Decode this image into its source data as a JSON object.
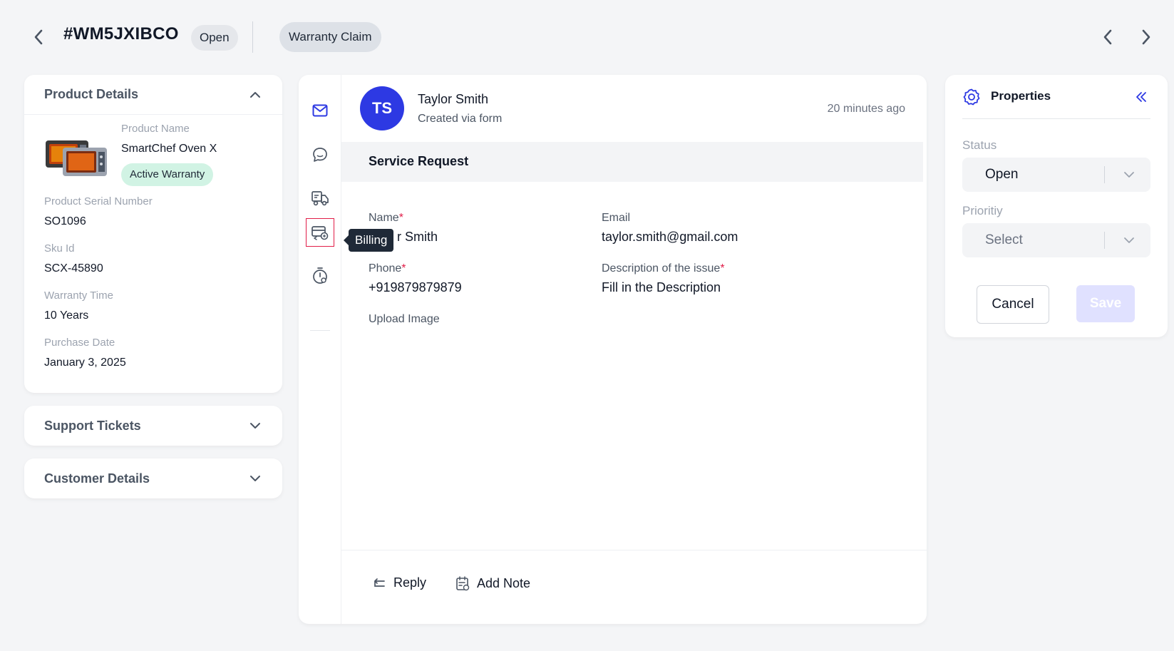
{
  "header": {
    "ticket_id": "#WM5JXIBCO",
    "status": "Open",
    "ticket_type": "Warranty Claim"
  },
  "product_details": {
    "title": "Product Details",
    "product_name_label": "Product Name",
    "product_name": "SmartChef Oven X",
    "warranty_badge": "Active Warranty",
    "fields": [
      {
        "label": "Product Serial Number",
        "value": "SO1096"
      },
      {
        "label": "Sku Id",
        "value": "SCX-45890"
      },
      {
        "label": "Warranty Time",
        "value": "10 Years"
      },
      {
        "label": "Purchase Date",
        "value": "January 3, 2025"
      }
    ]
  },
  "support_tickets": {
    "title": "Support Tickets"
  },
  "customer_details": {
    "title": "Customer Details"
  },
  "rail": {
    "tooltip": "Billing",
    "icons": [
      "mail-icon",
      "chat-icon",
      "truck-icon",
      "billing-icon",
      "timer-icon"
    ]
  },
  "message": {
    "avatar_initials": "TS",
    "sender": "Taylor Smith",
    "via": "Created via form",
    "time": "20 minutes ago",
    "section_title": "Service Request",
    "form": {
      "name_label": "Name",
      "name_value": "r Smith",
      "email_label": "Email",
      "email_value": "taylor.smith@gmail.com",
      "phone_label": "Phone",
      "phone_value": "+919879879879",
      "description_label": "Description of the issue",
      "description_value": "Fill in the Description",
      "upload_label": "Upload Image",
      "required_mark": "*"
    }
  },
  "actions": {
    "reply": "Reply",
    "add_note": "Add Note"
  },
  "properties": {
    "title": "Properties",
    "status_label": "Status",
    "status_value": "Open",
    "priority_label": "Prioritiy",
    "priority_value": "Select",
    "cancel": "Cancel",
    "save": "Save"
  },
  "colors": {
    "accent": "#2d39e3",
    "warranty_bg": "#d1f3e4",
    "required": "#e11d48",
    "save_disabled": "#e0e1ff"
  }
}
